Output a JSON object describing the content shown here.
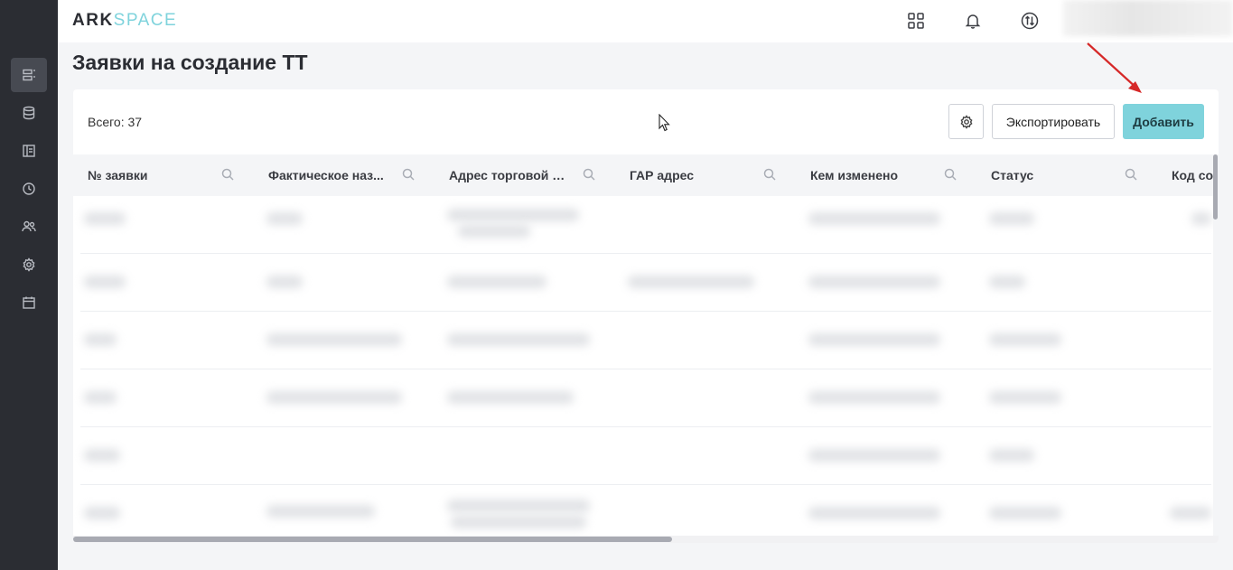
{
  "app": {
    "logo_ark": "ARK",
    "logo_space": "SPACE"
  },
  "sidebar": {
    "items": [
      {
        "icon": "requests-icon",
        "active": true
      },
      {
        "icon": "database-icon",
        "active": false
      },
      {
        "icon": "layout-icon",
        "active": false
      },
      {
        "icon": "clock-icon",
        "active": false
      },
      {
        "icon": "users-icon",
        "active": false
      },
      {
        "icon": "gear-icon",
        "active": false
      },
      {
        "icon": "calendar-icon",
        "active": false
      }
    ]
  },
  "topbar": {
    "icons": [
      "apps-grid-icon",
      "bell-icon",
      "sync-icon"
    ]
  },
  "page": {
    "title": "Заявки на создание ТТ"
  },
  "toolbar": {
    "total_label": "Всего: 37",
    "export_label": "Экспортировать",
    "add_label": "Добавить",
    "settings_icon": "gear-icon"
  },
  "table": {
    "columns": [
      {
        "label": "№ заявки"
      },
      {
        "label": "Фактическое наз..."
      },
      {
        "label": "Адрес торговой т..."
      },
      {
        "label": "ГАР адрес"
      },
      {
        "label": "Кем изменено"
      },
      {
        "label": "Статус"
      },
      {
        "label": "Код со"
      }
    ],
    "rows_visible": 6
  },
  "colors": {
    "accent": "#7fd3dc",
    "sidebar_bg": "#2b2d33",
    "annotation_arrow": "#d62828"
  }
}
